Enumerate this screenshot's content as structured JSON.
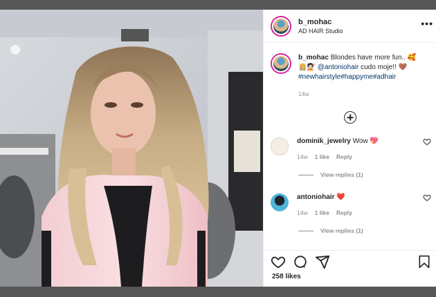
{
  "post": {
    "username": "b_mohac",
    "location": "AD HAIR Studio",
    "more_label": "•••",
    "caption": {
      "username": "b_mohac",
      "text": "Blondes have more fun..",
      "mention": "@antoniohair",
      "text2": "cudo moje!!",
      "hashtags": "#newhairstyle#happyme#adhair",
      "time": "14w"
    },
    "comments": [
      {
        "username": "dominik_jewelry",
        "text": "Wow",
        "time": "14w",
        "likes": "1 like",
        "reply": "Reply",
        "view_replies": "View replies (1)"
      },
      {
        "username": "antoniohair",
        "text": "",
        "time": "14w",
        "likes": "1 like",
        "reply": "Reply",
        "view_replies": "View replies (1)"
      }
    ],
    "likes_count": "258 likes"
  },
  "colors": {
    "accent_ring": "#d6249f",
    "heart": "#e0245e",
    "text": "#262626",
    "muted": "#8e8e8e",
    "link": "#00376b"
  },
  "icons": [
    "heart-icon",
    "comment-icon",
    "share-icon",
    "bookmark-icon",
    "add-comment-icon"
  ]
}
